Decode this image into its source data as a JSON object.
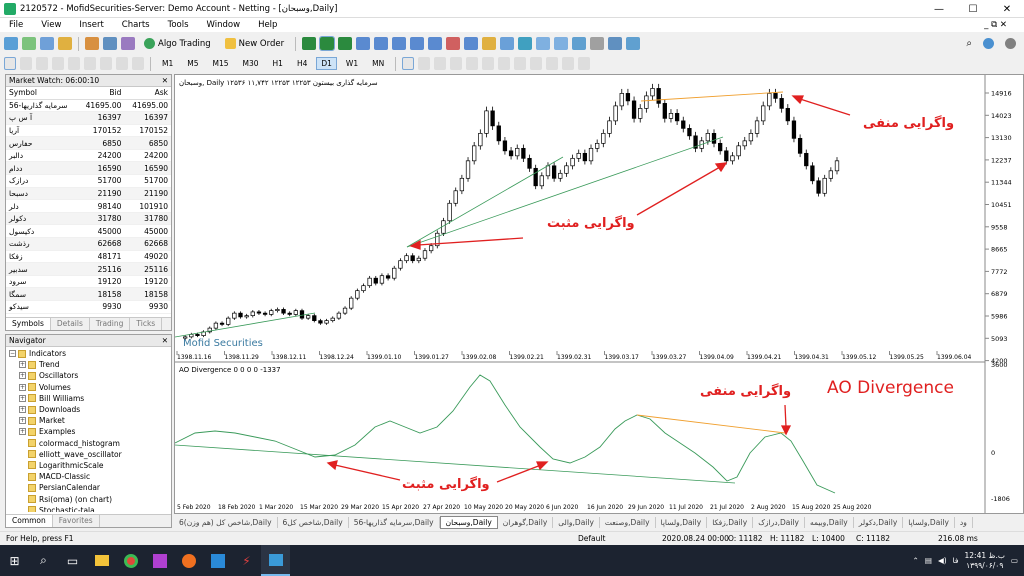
{
  "window": {
    "title": "2120572 - MofidSecurities-Server: Demo Account - Netting - [وسبحان,Daily]",
    "min": "—",
    "max": "☐",
    "close": "✕"
  },
  "menu": [
    "File",
    "View",
    "Insert",
    "Charts",
    "Tools",
    "Window",
    "Help"
  ],
  "menu_right": "_ ⧉ ✕",
  "toolbar": {
    "algo_trading": "Algo Trading",
    "new_order": "New Order"
  },
  "timeframes": [
    "M1",
    "M5",
    "M15",
    "M30",
    "H1",
    "H4",
    "D1",
    "W1",
    "MN"
  ],
  "active_timeframe": "D1",
  "market_watch": {
    "title": "Market Watch: 06:00:10",
    "headers": [
      "Symbol",
      "Bid",
      "Ask"
    ],
    "rows": [
      [
        "سرمایه گذاریها-56",
        "41695.00",
        "41695.00"
      ],
      [
        "آ س پ",
        "16397",
        "16397"
      ],
      [
        "آریا",
        "170152",
        "170152"
      ],
      [
        "حفارس",
        "6850",
        "6850"
      ],
      [
        "دالبر",
        "24200",
        "24200"
      ],
      [
        "ددام",
        "16590",
        "16590"
      ],
      [
        "درازک",
        "51700",
        "51700"
      ],
      [
        "دسبحا",
        "21190",
        "21190"
      ],
      [
        "دلر",
        "98140",
        "101910"
      ],
      [
        "دکولر",
        "31780",
        "31780"
      ],
      [
        "دکیسول",
        "45000",
        "45000"
      ],
      [
        "رذشت",
        "62668",
        "62668"
      ],
      [
        "زفکا",
        "48171",
        "49020"
      ],
      [
        "سدبیر",
        "25116",
        "25116"
      ],
      [
        "سرود",
        "19120",
        "19120"
      ],
      [
        "سمگا",
        "18158",
        "18158"
      ],
      [
        "سیدکو",
        "9930",
        "9930"
      ]
    ],
    "tabs": [
      "Symbols",
      "Details",
      "Trading",
      "Ticks"
    ]
  },
  "navigator": {
    "title": "Navigator",
    "items": [
      {
        "label": "Indicators",
        "level": 0,
        "pm": "−"
      },
      {
        "label": "Trend",
        "level": 1,
        "pm": "+"
      },
      {
        "label": "Oscillators",
        "level": 1,
        "pm": "+"
      },
      {
        "label": "Volumes",
        "level": 1,
        "pm": "+"
      },
      {
        "label": "Bill Williams",
        "level": 1,
        "pm": "+"
      },
      {
        "label": "Downloads",
        "level": 1,
        "pm": "+"
      },
      {
        "label": "Market",
        "level": 1,
        "pm": "+"
      },
      {
        "label": "Examples",
        "level": 1,
        "pm": "+"
      },
      {
        "label": "colormacd_histogram",
        "level": 1,
        "pm": ""
      },
      {
        "label": "elliott_wave_oscillator",
        "level": 1,
        "pm": ""
      },
      {
        "label": "LogarithmicScale",
        "level": 1,
        "pm": ""
      },
      {
        "label": "MACD-Classic",
        "level": 1,
        "pm": ""
      },
      {
        "label": "PersianCalendar",
        "level": 1,
        "pm": ""
      },
      {
        "label": "Rsi(oma) (on chart)",
        "level": 1,
        "pm": ""
      },
      {
        "label": "Stochastic-tala",
        "level": 1,
        "pm": ""
      }
    ],
    "tabs": [
      "Common",
      "Favorites"
    ]
  },
  "chart": {
    "symbol_header": "وسبحان, Daily  ۱۲۵۳۶ ۱۱,۷۴۲ ۱۲۲۵۳ ۱۲۲۵۳ سرمایه گذاری بیستون",
    "watermark": "Mofid Securities",
    "price_ticks": [
      "14916",
      "14023",
      "13130",
      "12237",
      "11344",
      "10451",
      "9558",
      "8665",
      "7772",
      "6879",
      "5986",
      "5093",
      "4200"
    ],
    "date_ticks": [
      "1398.11.16",
      "1398.11.29",
      "1398.12.11",
      "1398.12.24",
      "1399.01.10",
      "1399.01.27",
      "1399.02.08",
      "1399.02.21",
      "1399.02.31",
      "1399.03.17",
      "1399.03.27",
      "1399.04.09",
      "1399.04.21",
      "1399.04.31",
      "1399.05.12",
      "1399.05.25",
      "1399.06.04"
    ],
    "indicator_label": "AO Divergence 0 0 0 0 -1337",
    "ind_ticks": [
      "3600",
      "0",
      "-1806"
    ],
    "ind_date_ticks": [
      "5 Feb 2020",
      "18 Feb 2020",
      "1 Mar 2020",
      "15 Mar 2020",
      "29 Mar 2020",
      "15 Apr 2020",
      "27 Apr 2020",
      "10 May 2020",
      "20 May 2020",
      "6 Jun 2020",
      "16 Jun 2020",
      "29 Jun 2020",
      "11 Jul 2020",
      "21 Jul 2020",
      "2 Aug 2020",
      "15 Aug 2020",
      "25 Aug 2020"
    ],
    "ann_neg": "واگرایی منفی",
    "ann_pos": "واگرایی مثبت",
    "ann_title": "AO Divergence",
    "colors": {
      "bull": "#ffffff",
      "bear": "#000000",
      "pos_line": "#3a9a5a",
      "neg_line": "#f0a030",
      "arrow": "#e02020"
    }
  },
  "bottom_tabs": [
    "شاخص کل (هم وزن)6,Daily",
    "شاخص کل6,Daily",
    "سرمایه گذاریها-56,Daily",
    "وسبحان,Daily",
    "گوهران,Daily",
    "والی,Daily",
    "وصنعت,Daily",
    "ولساپا,Daily",
    "زفکا,Daily",
    "درازک,Daily",
    "وبیمه,Daily",
    "دکولر,Daily",
    "ولساپا,Daily",
    "ود"
  ],
  "active_bottom_tab": "وسبحان,Daily",
  "status": {
    "help": "For Help, press F1",
    "profile": "Default",
    "time": "2020.08.24 00:00",
    "open": "O: 11182",
    "high": "H: 11182",
    "low": "L: 10400",
    "close": "C: 11182",
    "traffic": "216.08 ms"
  },
  "taskbar": {
    "clock_time": "12:41 ب.ظ",
    "clock_date": "۱۳۹۹/۰۶/۰۹",
    "lang": "فا"
  }
}
